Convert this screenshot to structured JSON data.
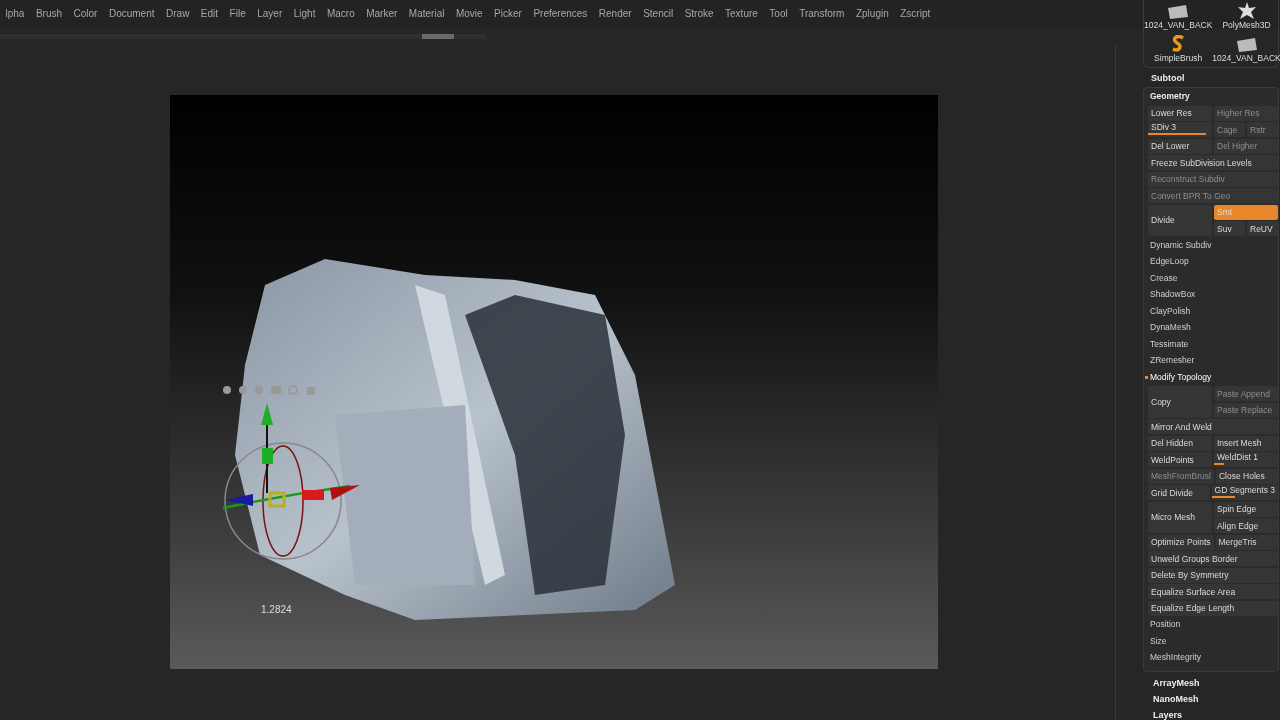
{
  "menu": [
    "lpha",
    "Brush",
    "Color",
    "Document",
    "Draw",
    "Edit",
    "File",
    "Layer",
    "Light",
    "Macro",
    "Marker",
    "Material",
    "Movie",
    "Picker",
    "Preferences",
    "Render",
    "Stencil",
    "Stroke",
    "Texture",
    "Tool",
    "Transform",
    "Zplugin",
    "Zscript"
  ],
  "canvas": {
    "scale_reading": "1.2824"
  },
  "tools": [
    {
      "label": "1024_VAN_BACK",
      "kind": "mesh"
    },
    {
      "label": "PolyMesh3D",
      "kind": "star"
    },
    {
      "label": "SimpleBrush",
      "kind": "brush"
    },
    {
      "label": "1024_VAN_BACK",
      "kind": "mesh"
    }
  ],
  "subtool": {
    "title": "Subtool"
  },
  "geometry": {
    "title": "Geometry",
    "rows": [
      {
        "kind": "split",
        "left": {
          "label": "Lower Res",
          "disabled": false
        },
        "right": [
          [
            {
              "label": "Higher Res",
              "disabled": true
            }
          ]
        ]
      },
      {
        "kind": "split",
        "left": {
          "label": "SDiv 3",
          "level": 0.9
        },
        "right": [
          [
            {
              "label": "Cage",
              "disabled": true
            },
            {
              "label": "Rstr",
              "disabled": true
            }
          ]
        ]
      },
      {
        "kind": "split",
        "left": {
          "label": "Del Lower",
          "disabled": false
        },
        "right": [
          [
            {
              "label": "Del Higher",
              "disabled": true
            }
          ]
        ]
      },
      {
        "kind": "full",
        "cell": {
          "label": "Freeze SubDivision Levels",
          "disabled": false
        }
      },
      {
        "kind": "full",
        "cell": {
          "label": "Reconstruct Subdiv",
          "disabled": true
        }
      },
      {
        "kind": "full",
        "cell": {
          "label": "Convert BPR To Geo",
          "disabled": true
        }
      },
      {
        "kind": "split",
        "left": {
          "label": "Divide",
          "disabled": false
        },
        "right": [
          [
            {
              "label": "Smt",
              "on": true
            }
          ],
          [
            {
              "label": "Suv",
              "on": false
            },
            {
              "label": "ReUV",
              "on": false
            }
          ]
        ]
      },
      {
        "kind": "item",
        "label": "Dynamic Subdiv"
      },
      {
        "kind": "item",
        "label": "EdgeLoop"
      },
      {
        "kind": "item",
        "label": "Crease"
      },
      {
        "kind": "item",
        "label": "ShadowBox"
      },
      {
        "kind": "item",
        "label": "ClayPolish"
      },
      {
        "kind": "item",
        "label": "DynaMesh"
      },
      {
        "kind": "item",
        "label": "Tessimate"
      },
      {
        "kind": "item",
        "label": "ZRemesher"
      },
      {
        "kind": "section",
        "label": "Modify Topology",
        "expanded": true
      },
      {
        "kind": "split",
        "left": {
          "label": "Copy",
          "disabled": false
        },
        "right": [
          [
            {
              "label": "Paste Append",
              "disabled": true
            }
          ],
          [
            {
              "label": "Paste Replace",
              "disabled": true
            }
          ]
        ]
      },
      {
        "kind": "full",
        "cell": {
          "label": "Mirror And Weld",
          "disabled": false
        }
      },
      {
        "kind": "split",
        "left": {
          "label": "Del Hidden",
          "disabled": false
        },
        "right": [
          [
            {
              "label": "Insert Mesh",
              "disabled": false
            }
          ]
        ]
      },
      {
        "kind": "split",
        "left": {
          "label": "WeldPoints",
          "disabled": false
        },
        "right": [
          [
            {
              "label": "WeldDist 1",
              "level": 0.15
            }
          ]
        ]
      },
      {
        "kind": "split",
        "left": {
          "label": "MeshFromBrusl",
          "disabled": true
        },
        "right": [
          [
            {
              "label": "Close Holes",
              "disabled": false
            }
          ]
        ]
      },
      {
        "kind": "split",
        "left": {
          "label": "Grid Divide",
          "disabled": false
        },
        "right": [
          [
            {
              "label": "GD Segments 3",
              "level": 0.35
            }
          ]
        ]
      },
      {
        "kind": "split",
        "left": {
          "label": "Micro Mesh",
          "disabled": false
        },
        "right": [
          [
            {
              "label": "Spin Edge",
              "disabled": false
            }
          ],
          [
            {
              "label": "Align Edge",
              "disabled": false
            }
          ]
        ]
      },
      {
        "kind": "split",
        "left": {
          "label": "Optimize Points",
          "disabled": false
        },
        "right": [
          [
            {
              "label": "MergeTris",
              "disabled": false
            }
          ]
        ]
      },
      {
        "kind": "full",
        "cell": {
          "label": "Unweld Groups Border",
          "disabled": false
        }
      },
      {
        "kind": "full",
        "cell": {
          "label": "Delete By Symmetry",
          "disabled": false
        }
      },
      {
        "kind": "full",
        "cell": {
          "label": "Equalize Surface Area",
          "disabled": false
        }
      },
      {
        "kind": "full",
        "cell": {
          "label": "Equalize Edge Length",
          "disabled": false
        }
      },
      {
        "kind": "item",
        "label": "Position"
      },
      {
        "kind": "item",
        "label": "Size"
      },
      {
        "kind": "item",
        "label": "MeshIntegrity"
      }
    ]
  },
  "sections": [
    "ArrayMesh",
    "NanoMesh",
    "Layers"
  ]
}
